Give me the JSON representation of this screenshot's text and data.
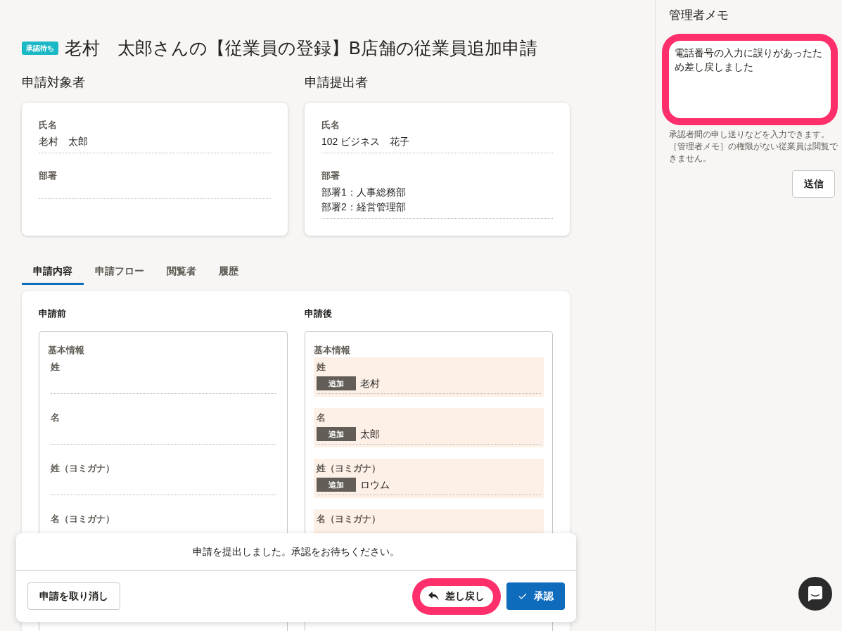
{
  "header": {
    "status_badge": "承認待ち",
    "title": "老村　太郎さんの【従業員の登録】B店舗の従業員追加申請"
  },
  "parties": [
    {
      "heading": "申請対象者",
      "fields": [
        {
          "label": "氏名",
          "lines": [
            "老村　太郎"
          ]
        },
        {
          "label": "部署"
        }
      ]
    },
    {
      "heading": "申請提出者",
      "fields": [
        {
          "label": "氏名",
          "lines": [
            "102 ビジネス　花子"
          ]
        },
        {
          "label": "部署",
          "lines": [
            "部署1：人事総務部",
            "部署2：経営管理部"
          ]
        }
      ]
    }
  ],
  "tabs": [
    {
      "label": "申請内容",
      "selected": true
    },
    {
      "label": "申請フロー",
      "selected": false
    },
    {
      "label": "閲覧者",
      "selected": false
    },
    {
      "label": "履歴",
      "selected": false
    }
  ],
  "comparison": [
    {
      "heading": "申請前",
      "section": "基本情報",
      "fields": [
        {
          "label": "姓",
          "changed": false
        },
        {
          "label": "名",
          "changed": false
        },
        {
          "label": "姓（ヨミガナ）",
          "changed": false
        },
        {
          "label": "名（ヨミガナ）",
          "changed": false
        }
      ]
    },
    {
      "heading": "申請後",
      "section": "基本情報",
      "fields": [
        {
          "label": "姓",
          "changed": true,
          "badge": "追加",
          "value": "老村"
        },
        {
          "label": "名",
          "changed": true,
          "badge": "追加",
          "value": "太郎"
        },
        {
          "label": "姓（ヨミガナ）",
          "changed": true,
          "badge": "追加",
          "value": "ロウム"
        },
        {
          "label": "名（ヨミガナ）",
          "changed": true
        }
      ]
    }
  ],
  "action_bar": {
    "message": "申請を提出しました。承認をお待ちください。",
    "buttons": [
      {
        "kind": "cancel",
        "label": "申請を取り消し",
        "highlighted": false
      },
      {
        "kind": "return",
        "label": "差し戻し",
        "highlighted": true
      },
      {
        "kind": "approve",
        "label": "承認",
        "highlighted": false
      }
    ]
  },
  "admin_memo": {
    "title": "管理者メモ",
    "value": "電話番号の入力に誤りがあったため差し戻しました",
    "highlighted": true,
    "hint": [
      "承認者間の申し送りなどを入力できます。",
      "［管理者メモ］の権限がない従業員は閲覧できません。"
    ],
    "submit_button": "送信"
  }
}
